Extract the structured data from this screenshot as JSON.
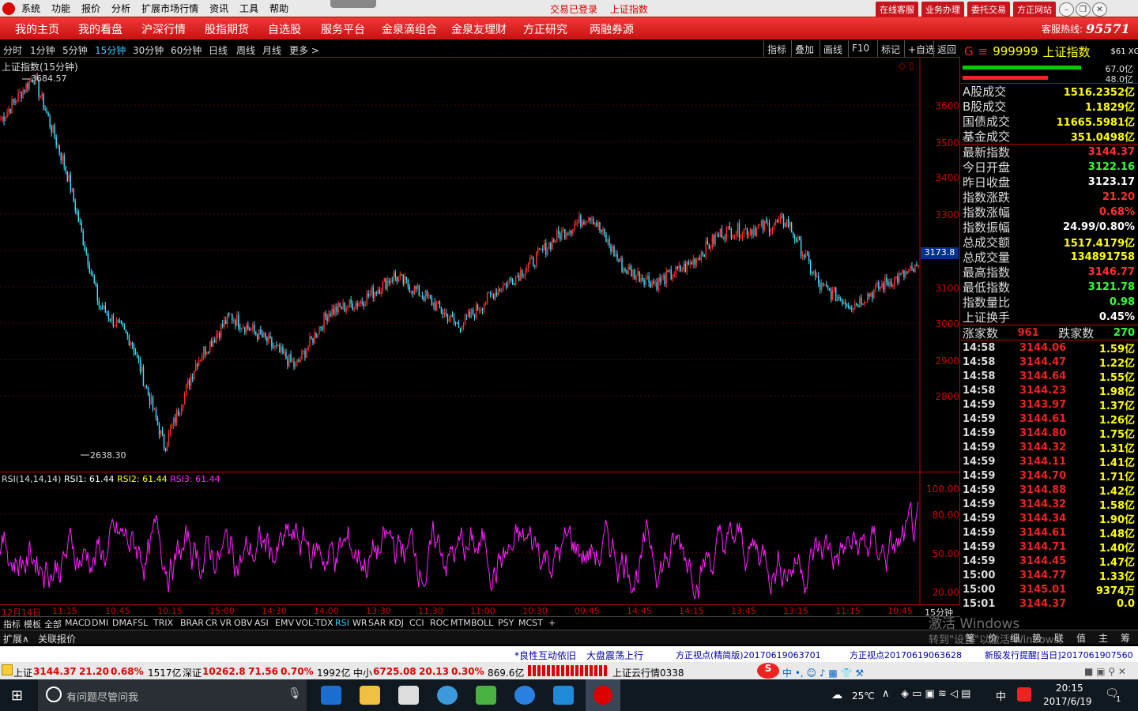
{
  "menubar": {
    "items": [
      "系统",
      "功能",
      "报价",
      "分析",
      "扩展市场行情",
      "资讯",
      "工具",
      "帮助"
    ],
    "status_login": "交易已登录",
    "status_index": "上证指数",
    "buttons": [
      "在线客服",
      "业务办理",
      "委托交易",
      "方正网站"
    ]
  },
  "navbar": {
    "items": [
      "我的主页",
      "我的看盘",
      "沪深行情",
      "股指期货",
      "自选股",
      "服务平台",
      "金泉滴组合",
      "金泉友理财",
      "方正研究",
      "两融券源"
    ],
    "hotline_label": "客服热线:",
    "hotline_number": "95571"
  },
  "periodbar": {
    "periods": [
      "分时",
      "1分钟",
      "5分钟",
      "15分钟",
      "30分钟",
      "60分钟",
      "日线",
      "周线",
      "月线",
      "更多 >"
    ],
    "active": "15分钟",
    "tools": [
      "指标",
      "叠加",
      "画线",
      "F10",
      "标记",
      "+自选",
      "返回"
    ]
  },
  "chart": {
    "title": "上证指数(15分钟)",
    "high_label": "3684.57",
    "low_label": "2638.30",
    "price_ticks": [
      "3600",
      "3500",
      "3400",
      "3300",
      "3200",
      "3100",
      "3000",
      "2900",
      "2800"
    ],
    "current_marker": "3173.8",
    "rsi_title": "RSI(14,14,14)",
    "rsi1": "RSI1: 61.44",
    "rsi2": "RSI2: 61.44",
    "rsi3": "RSI3: 61.44",
    "rsi_ticks": [
      "100.00",
      "80.00",
      "50.00",
      "20.00"
    ],
    "time_labels": [
      "12月14日",
      "11:15",
      "10:45",
      "10:15",
      "15:00",
      "14:30",
      "14:00",
      "13:30",
      "11:30",
      "11:00",
      "10:30",
      "09:45",
      "14:45",
      "14:15",
      "13:45",
      "13:15",
      "11:15",
      "10:45",
      "15分钟"
    ],
    "colors": {
      "up": "#ff3030",
      "down": "#40e0ff",
      "rsi": "#ff20ff"
    }
  },
  "chart_data": [
    {
      "type": "line",
      "title": "上证指数(15分钟)",
      "series": [],
      "x": [
        "12月14日",
        "11:15",
        "10:45",
        "10:15",
        "15:00",
        "14:30",
        "14:00",
        "13:30",
        "11:30",
        "11:00",
        "10:30",
        "09:45",
        "14:45",
        "14:15",
        "13:45",
        "13:15",
        "11:15",
        "10:45"
      ],
      "values": [
        3560,
        3680,
        3420,
        3050,
        2950,
        2660,
        2900,
        3020,
        2960,
        2880,
        3030,
        3060,
        3130,
        3070,
        2990,
        3080,
        3150,
        3240,
        3300,
        3150,
        3110,
        3160,
        3250,
        3260,
        3280,
        3100,
        3050,
        3110,
        3150
      ],
      "ylim": [
        2600,
        3700
      ],
      "annotations": [
        "3684.57",
        "2638.30"
      ]
    },
    {
      "type": "line",
      "title": "RSI(14,14,14)",
      "series": [
        {
          "name": "RSI1",
          "values": [
            61.44
          ]
        },
        {
          "name": "RSI2",
          "values": [
            61.44
          ]
        },
        {
          "name": "RSI3",
          "values": [
            61.44
          ]
        }
      ],
      "ylim": [
        20,
        100
      ]
    }
  ],
  "indicators": [
    "指标",
    "模板",
    "全部",
    "MACD",
    "DMI",
    "DMA",
    "FSL",
    "TRIX",
    "BRAR",
    "CR",
    "VR",
    "OBV",
    "ASI",
    "EMV",
    "VOL-TDX",
    "RSI",
    "WR",
    "SAR",
    "KDJ",
    "CCI",
    "ROC",
    "MTM",
    "BOLL",
    "PSY",
    "MCST",
    "+"
  ],
  "active_indicator": "RSI",
  "extbar": {
    "left": [
      "扩展∧",
      "关联报价"
    ]
  },
  "rpanel": {
    "g_label": "G",
    "code": "999999",
    "name": "上证指数",
    "tag": "$61 XG3",
    "bar1_val": "67.0亿",
    "bar2_val": "48.0亿",
    "volumes": [
      {
        "k": "A股成交",
        "v": "1516.2352亿"
      },
      {
        "k": "B股成交",
        "v": "1.1829亿"
      },
      {
        "k": "国债成交",
        "v": "11665.5981亿"
      },
      {
        "k": "基金成交",
        "v": "351.0498亿"
      }
    ],
    "stats": [
      {
        "k": "最新指数",
        "v": "3144.37",
        "c": "#ff3030"
      },
      {
        "k": "今日开盘",
        "v": "3122.16",
        "c": "#3f3"
      },
      {
        "k": "昨日收盘",
        "v": "3123.17",
        "c": "#fff"
      },
      {
        "k": "指数涨跌",
        "v": "21.20",
        "c": "#ff3030"
      },
      {
        "k": "指数涨幅",
        "v": "0.68%",
        "c": "#ff3030"
      },
      {
        "k": "指数振幅",
        "v": "24.99/0.80%",
        "c": "#fff"
      },
      {
        "k": "总成交额",
        "v": "1517.4179亿",
        "c": "#ff0"
      },
      {
        "k": "总成交量",
        "v": "134891758",
        "c": "#ff0"
      },
      {
        "k": "最高指数",
        "v": "3146.77",
        "c": "#ff3030"
      },
      {
        "k": "最低指数",
        "v": "3121.78",
        "c": "#3f3"
      },
      {
        "k": "指数量比",
        "v": "0.98",
        "c": "#3f3"
      },
      {
        "k": "上证换手",
        "v": "0.45%",
        "c": "#fff"
      }
    ],
    "rise_label": "涨家数",
    "rise_count": "961",
    "fall_label": "跌家数",
    "fall_count": "270",
    "ticks": [
      {
        "t": "14:58",
        "p": "3144.06",
        "q": "1.59亿"
      },
      {
        "t": "14:58",
        "p": "3144.47",
        "q": "1.22亿"
      },
      {
        "t": "14:58",
        "p": "3144.64",
        "q": "1.55亿"
      },
      {
        "t": "14:58",
        "p": "3144.23",
        "q": "1.98亿"
      },
      {
        "t": "14:59",
        "p": "3143.97",
        "q": "1.37亿"
      },
      {
        "t": "14:59",
        "p": "3144.61",
        "q": "1.26亿"
      },
      {
        "t": "14:59",
        "p": "3144.80",
        "q": "1.75亿"
      },
      {
        "t": "14:59",
        "p": "3144.32",
        "q": "1.31亿"
      },
      {
        "t": "14:59",
        "p": "3144.11",
        "q": "1.41亿"
      },
      {
        "t": "14:59",
        "p": "3144.70",
        "q": "1.71亿"
      },
      {
        "t": "14:59",
        "p": "3144.88",
        "q": "1.42亿"
      },
      {
        "t": "14:59",
        "p": "3144.32",
        "q": "1.58亿"
      },
      {
        "t": "14:59",
        "p": "3144.34",
        "q": "1.90亿"
      },
      {
        "t": "14:59",
        "p": "3144.61",
        "q": "1.48亿"
      },
      {
        "t": "14:59",
        "p": "3144.71",
        "q": "1.40亿"
      },
      {
        "t": "14:59",
        "p": "3144.45",
        "q": "1.47亿"
      },
      {
        "t": "15:00",
        "p": "3144.77",
        "q": "1.33亿"
      },
      {
        "t": "15:00",
        "p": "3145.01",
        "q": "9374万"
      },
      {
        "t": "15:01",
        "p": "3144.37",
        "q": "0.0"
      }
    ],
    "tabs": [
      "笔",
      "价",
      "细",
      "势",
      "联",
      "值",
      "主",
      "筹"
    ]
  },
  "watermark": {
    "line1": "激活 Windows",
    "line2": "转到\"设置\"以激活 Windows。"
  },
  "news": [
    "*良性互动依旧",
    "大盘震荡上行",
    "方正视点(精简版)20170619063701",
    "方正视点20170619063628",
    "新股发行提醒[当日]2017061907560"
  ],
  "ticker": {
    "sh_label": "上证",
    "sh_price": "3144.37",
    "sh_chg": "21.20",
    "sh_pct": "0.68%",
    "sh_vol": "1517亿",
    "sz_label": "深证",
    "sz_price": "10262.8",
    "sz_chg": "71.56",
    "sz_pct": "0.70%",
    "sz_vol": "1992亿",
    "zx_label": "中小",
    "zx_price": "6725.08",
    "zx_chg": "20.13",
    "zx_pct": "0.30%",
    "zx_vol": "869.6亿",
    "cloud": "上证云行情0338"
  },
  "taskbar": {
    "search_placeholder": "有问题尽管问我",
    "weather": "25℃",
    "ime": "中",
    "time": "20:15",
    "date": "2017/6/19",
    "notif": "1"
  }
}
